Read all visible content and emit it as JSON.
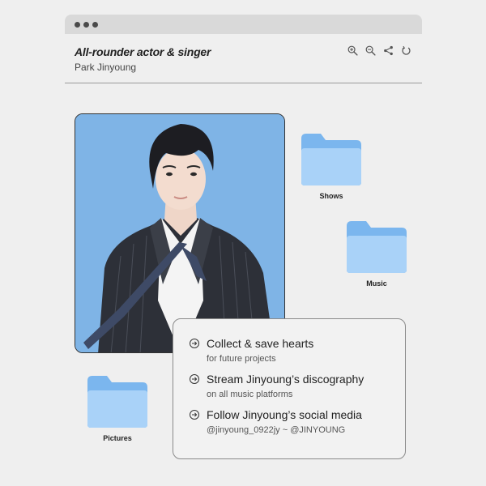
{
  "window": {
    "title": "All-rounder actor & singer",
    "subtitle": "Park Jinyoung"
  },
  "toolbar": {
    "icons": [
      "zoom-in-icon",
      "zoom-out-icon",
      "share-icon",
      "refresh-icon"
    ]
  },
  "folders": [
    {
      "label": "Shows"
    },
    {
      "label": "Music"
    },
    {
      "label": "Pictures"
    }
  ],
  "info": {
    "items": [
      {
        "title": "Collect & save hearts",
        "subtitle": "for future projects"
      },
      {
        "title": "Stream Jinyoung’s discography",
        "subtitle": "on all music platforms"
      },
      {
        "title": "Follow Jinyoung’s social media",
        "subtitle": "@jinyoung_0922jy ~ @JINYOUNG"
      }
    ]
  },
  "colors": {
    "background": "#efefef",
    "titlebar": "#d9d9d9",
    "photo_background": "#7fb4e6",
    "folder_back": "#7bb6ee",
    "folder_front": "#a9d2f8"
  }
}
